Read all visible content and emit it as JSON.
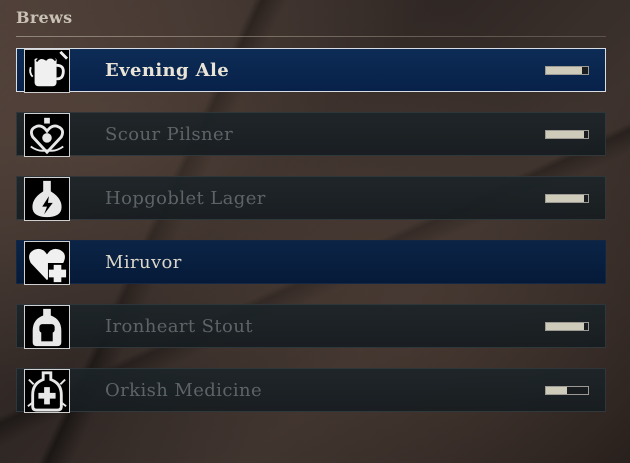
{
  "panel": {
    "title": "Brews"
  },
  "brews": [
    {
      "label": "Evening Ale",
      "icon": "tankard-icon",
      "state": "selected",
      "fill": 0.85
    },
    {
      "label": "Scour Pilsner",
      "icon": "heart-bottle-icon",
      "state": "normal",
      "fill": 0.9
    },
    {
      "label": "Hopgoblet Lager",
      "icon": "lightning-flask-icon",
      "state": "normal",
      "fill": 0.9
    },
    {
      "label": "Miruvor",
      "icon": "heart-plus-icon",
      "state": "highlighted",
      "fill": null
    },
    {
      "label": "Ironheart Stout",
      "icon": "fist-bottle-icon",
      "state": "normal",
      "fill": 0.9
    },
    {
      "label": "Orkish Medicine",
      "icon": "medicine-bottle-icon",
      "state": "normal",
      "fill": 0.5
    }
  ]
}
